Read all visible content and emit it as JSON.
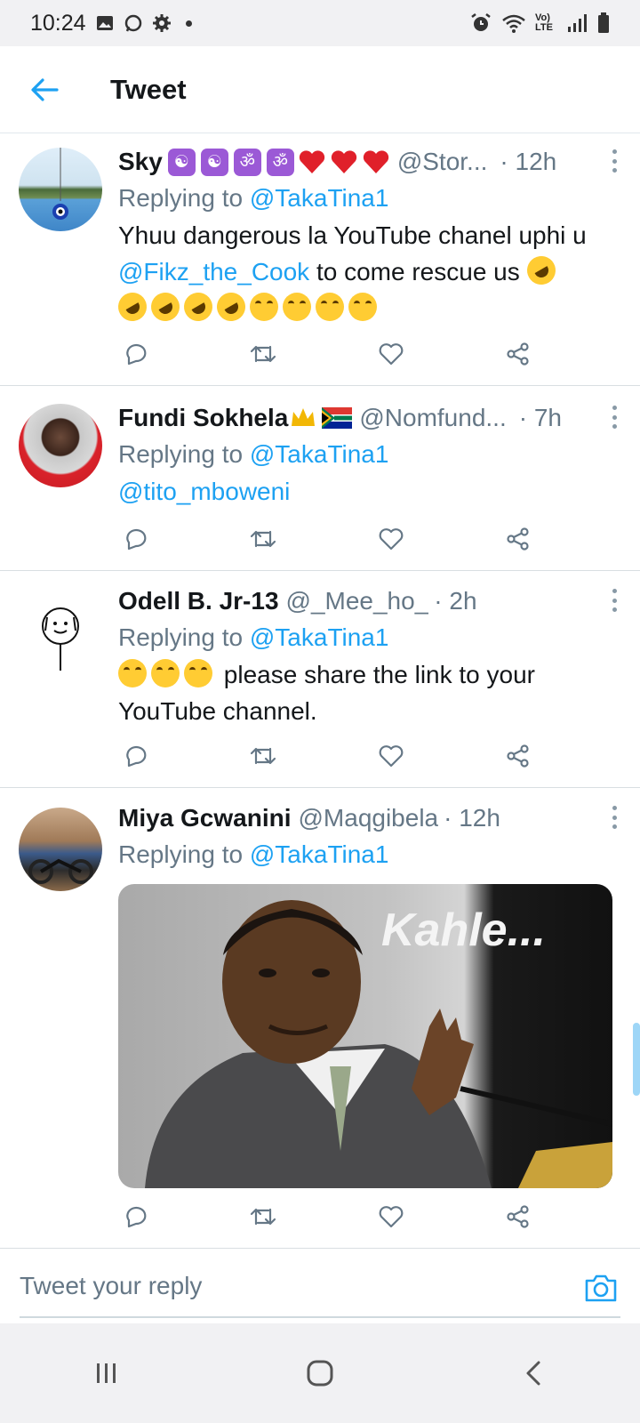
{
  "status_bar": {
    "time": "10:24",
    "network": "Vo) LTE"
  },
  "header": {
    "title": "Tweet"
  },
  "tweets": [
    {
      "name": "Sky",
      "handle": "@Stor...",
      "time": "· 12h",
      "replying_label": "Replying to",
      "replying_to": "@TakaTina1",
      "text_part1": "Yhuu dangerous la YouTube chanel uphi u",
      "text_mention": "@Fikz_the_Cook",
      "text_part2": " to come rescue us"
    },
    {
      "name": "Fundi Sokhela",
      "handle": "@Nomfund...",
      "time": "· 7h",
      "replying_label": "Replying to",
      "replying_to": "@TakaTina1",
      "text_mention": "@tito_mboweni"
    },
    {
      "name": "Odell B. Jr-13",
      "handle": "@_Mee_ho_",
      "time": "· 2h",
      "replying_label": "Replying to",
      "replying_to": "@TakaTina1",
      "text_part1": "please share the link to your YouTube channel."
    },
    {
      "name": "Miya Gcwanini",
      "handle": "@Maqgibela",
      "time": "· 12h",
      "replying_label": "Replying to",
      "replying_to": "@TakaTina1",
      "media_caption": "Kahle..."
    }
  ],
  "composer": {
    "placeholder": "Tweet your reply"
  },
  "icons": {
    "back": "arrow-left-icon",
    "more": "more-vertical-icon",
    "reply": "reply-icon",
    "retweet": "retweet-icon",
    "like": "heart-icon",
    "share": "share-icon",
    "camera": "camera-icon",
    "recents": "recents-icon",
    "home": "home-icon",
    "nav_back": "chevron-left-icon"
  },
  "colors": {
    "accent": "#1da1f2",
    "secondary_text": "#657786",
    "primary_text": "#14171a"
  }
}
